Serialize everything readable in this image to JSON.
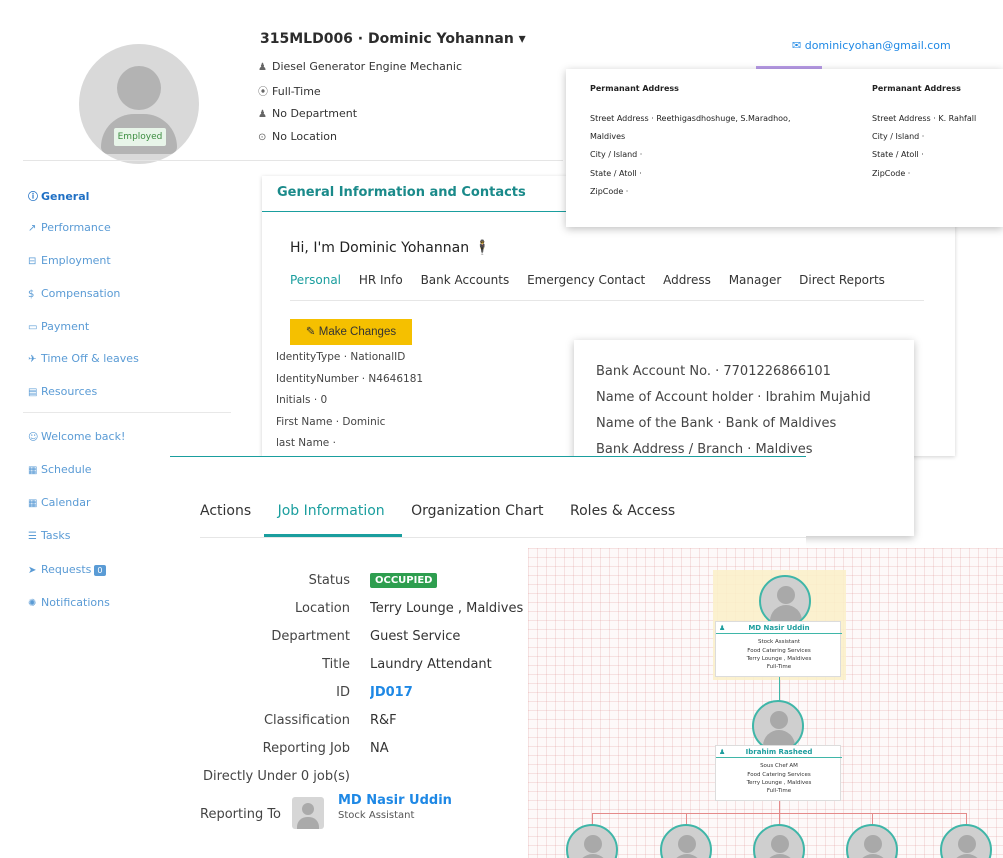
{
  "profile": {
    "status_badge": "Employed",
    "title": "315MLD006 · Dominic Yohannan ▾",
    "job": "Diesel Generator Engine Mechanic",
    "employment_type": "Full-Time",
    "department": "No Department",
    "location": "No Location",
    "email": "dominicyohan@gmail.com"
  },
  "sidebar": {
    "items": [
      {
        "icon": "info-icon",
        "glyph": "ⓘ",
        "label": "General"
      },
      {
        "icon": "chart-icon",
        "glyph": "↗",
        "label": "Performance"
      },
      {
        "icon": "briefcase-icon",
        "glyph": "⊟",
        "label": "Employment"
      },
      {
        "icon": "money-icon",
        "glyph": "$",
        "label": "Compensation"
      },
      {
        "icon": "card-icon",
        "glyph": "▭",
        "label": "Payment"
      },
      {
        "icon": "plane-icon",
        "glyph": "✈",
        "label": "Time Off & leaves"
      },
      {
        "icon": "folder-icon",
        "glyph": "▤",
        "label": "Resources"
      },
      {
        "icon": "smile-icon",
        "glyph": "☺",
        "label": "Welcome back!"
      },
      {
        "icon": "calendar-icon",
        "glyph": "▦",
        "label": "Schedule"
      },
      {
        "icon": "calendar-icon",
        "glyph": "▦",
        "label": "Calendar"
      },
      {
        "icon": "list-icon",
        "glyph": "☰",
        "label": "Tasks"
      },
      {
        "icon": "send-icon",
        "glyph": "➤",
        "label": "Requests"
      },
      {
        "icon": "bell-icon",
        "glyph": "✺",
        "label": "Notifications"
      }
    ],
    "requests_count": "0"
  },
  "general": {
    "panel_title": "General Information and Contacts",
    "greeting": "Hi, I'm Dominic Yohannan",
    "tabs": [
      "Personal",
      "HR Info",
      "Bank Accounts",
      "Emergency Contact",
      "Address",
      "Manager",
      "Direct Reports"
    ],
    "make_changes": "Make Changes",
    "fields": [
      "IdentityType · NationalID",
      "IdentityNumber · N4646181",
      "Initials · 0",
      "First Name · Dominic",
      "last Name ·"
    ]
  },
  "address": {
    "col1": {
      "heading": "Permanant Address",
      "street": "Street Address · Reethigasdhoshuge, S.Maradhoo,",
      "street2": "Maldives",
      "city": "City / Island ·",
      "state": "State / Atoll ·",
      "zip": "ZipCode ·"
    },
    "col2": {
      "heading": "Permanant Address",
      "street": "Street Address · K. Rahfall",
      "city": "City / Island ·",
      "state": "State / Atoll ·",
      "zip": "ZipCode ·"
    }
  },
  "bank": {
    "account_no": "Bank Account No. · 7701226866101",
    "holder": "Name of Account holder · Ibrahim Mujahid",
    "bank_name": "Name of the Bank · Bank of Maldives",
    "branch": "Bank Address / Branch · Maldives"
  },
  "job": {
    "tabs": [
      "Actions",
      "Job Information",
      "Organization Chart",
      "Roles & Access"
    ],
    "labels": {
      "status": "Status",
      "location": "Location",
      "department": "Department",
      "title": "Title",
      "id": "ID",
      "classification": "Classification",
      "reporting_job": "Reporting Job",
      "directly_under": "Directly Under 0 job(s)",
      "reporting_to": "Reporting To"
    },
    "values": {
      "status": "OCCUPIED",
      "location": "Terry Lounge , Maldives",
      "department": "Guest Service",
      "title": "Laundry Attendant",
      "id": "JD017",
      "classification": "R&F",
      "reporting_job": "NA",
      "reporting_to_name": "MD Nasir Uddin",
      "reporting_to_role": "Stock Assistant"
    }
  },
  "org_chart": {
    "nodes": [
      {
        "name": "MD Nasir Uddin",
        "role": "Stock Assistant",
        "dept": "Food Catering Services",
        "loc": "Terry Lounge , Maldives",
        "type": "Full-Time"
      },
      {
        "name": "Ibrahim Rasheed",
        "role": "Sous Chef AM",
        "dept": "Food Catering Services",
        "loc": "Terry Lounge , Maldives",
        "type": "Full-Time"
      }
    ]
  }
}
